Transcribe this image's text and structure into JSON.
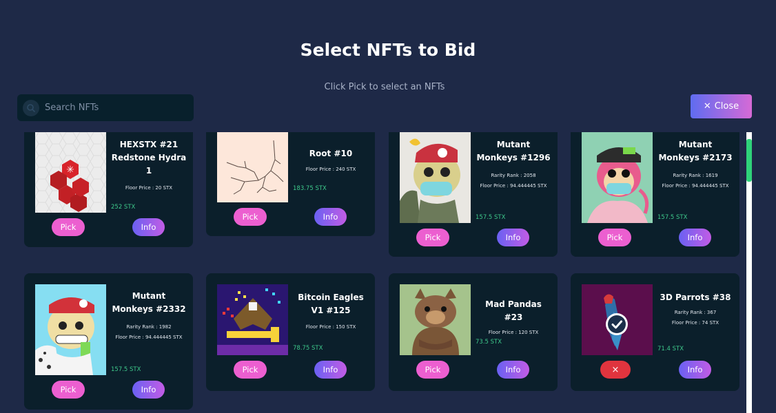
{
  "header": {
    "title": "Select NFTs to Bid",
    "subtitle": "Click Pick to select an NFTs"
  },
  "search": {
    "placeholder": "Search NFTs",
    "icon": "search-icon"
  },
  "close_button": {
    "label": "Close",
    "icon": "close-icon"
  },
  "buttons": {
    "pick": "Pick",
    "info": "Info",
    "remove": "×"
  },
  "colors": {
    "background": "#1e2947",
    "card": "#0b1f2b",
    "pick": "#ec5fd0",
    "price": "#3ec98b",
    "remove": "#e0343e"
  },
  "cards": [
    {
      "name": "HEXSTX #21 Redstone Hydra 1",
      "rank": "",
      "floor": "Floor Price : 20 STX",
      "price": "252 STX"
    },
    {
      "name": "Root #10",
      "rank": "",
      "floor": "Floor Price : 240 STX",
      "price": "183.75 STX"
    },
    {
      "name": "Mutant Monkeys #1296",
      "rank": "Rarity Rank : 2058",
      "floor": "Floor Price : 94.444445 STX",
      "price": "157.5 STX"
    },
    {
      "name": "Mutant Monkeys #2173",
      "rank": "Rarity Rank : 1619",
      "floor": "Floor Price : 94.444445 STX",
      "price": "157.5 STX"
    },
    {
      "name": "Mutant Monkeys #2332",
      "rank": "Rarity Rank : 1982",
      "floor": "Floor Price : 94.444445 STX",
      "price": "157.5 STX"
    },
    {
      "name": "Bitcoin Eagles V1 #125",
      "rank": "",
      "floor": "Floor Price : 150 STX",
      "price": "78.75 STX"
    },
    {
      "name": "Mad Pandas #23",
      "rank": "",
      "floor": "Floor Price : 120 STX",
      "price": "73.5 STX"
    },
    {
      "name": "3D Parrots #38",
      "rank": "Rarity Rank : 367",
      "floor": "Floor Price : 74 STX",
      "price": "71.4 STX",
      "selected": true
    }
  ]
}
